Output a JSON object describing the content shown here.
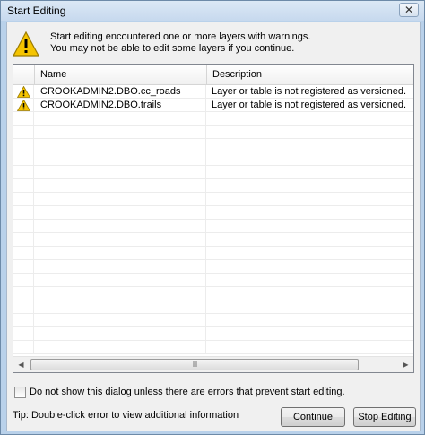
{
  "window": {
    "title": "Start Editing",
    "close_label": "✕"
  },
  "message": {
    "line1": "Start editing encountered one or more layers with warnings.",
    "line2": "You may not be able to edit some layers if you continue."
  },
  "grid": {
    "columns": {
      "name": "Name",
      "description": "Description"
    },
    "rows": [
      {
        "icon": "warning-icon",
        "name": "CROOKADMIN2.DBO.cc_roads",
        "description": "Layer or table is not registered as versioned."
      },
      {
        "icon": "warning-icon",
        "name": "CROOKADMIN2.DBO.trails",
        "description": "Layer or table is not registered as versioned."
      }
    ],
    "scrollbar": {
      "left_arrow": "◀",
      "right_arrow": "▶",
      "grip": "III"
    }
  },
  "footer": {
    "checkbox_label": "Do not show this dialog unless there are errors that prevent start editing.",
    "checkbox_checked": false,
    "tip": "Tip: Double-click error to view additional information",
    "continue_label": "Continue",
    "stop_label": "Stop Editing"
  },
  "colors": {
    "warning_fill": "#f5c400",
    "warning_stroke": "#9a7a00",
    "grid_border": "#828790"
  }
}
